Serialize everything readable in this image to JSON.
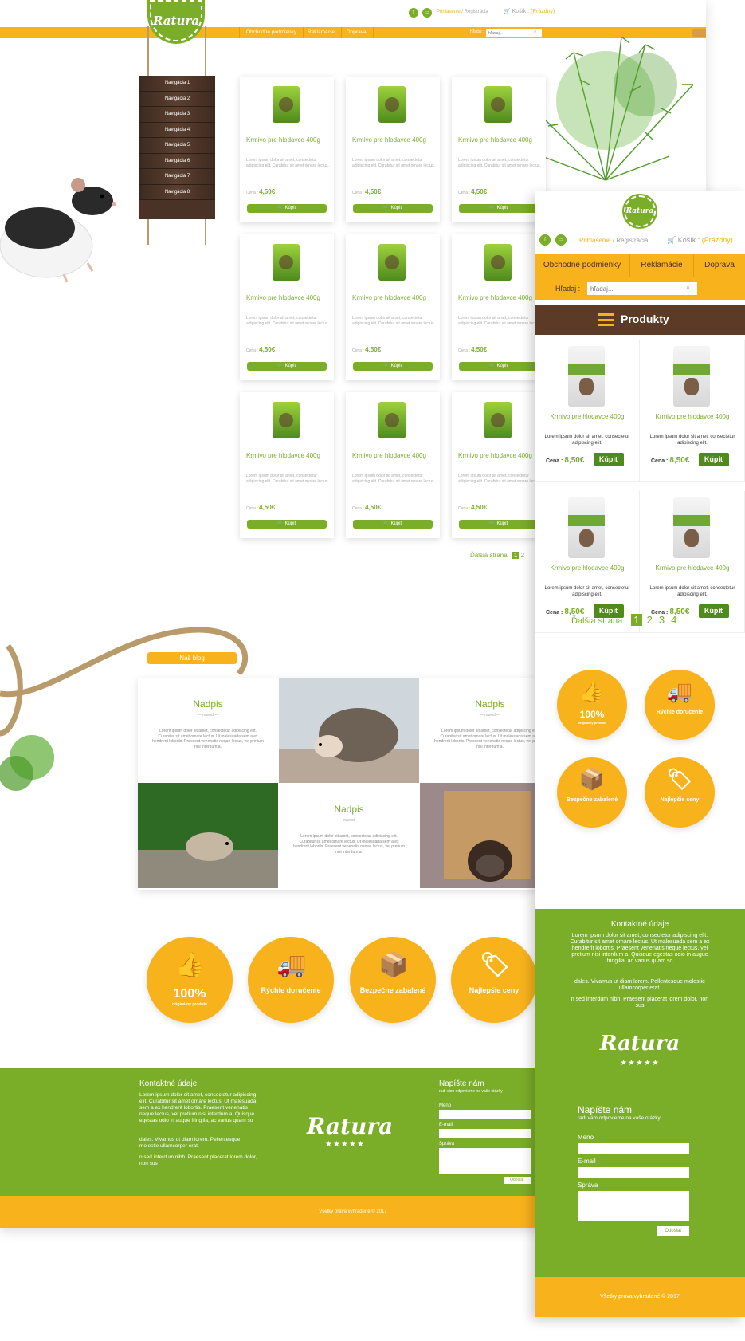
{
  "desktop": {
    "logo": "Ratura",
    "header": {
      "login": "Prihlásenie",
      "sep": "/",
      "register": "Registrácia",
      "cart": "Košík :",
      "cart_state": "(Prázdny)"
    },
    "nav": [
      "Obchodné podmienky",
      "Reklamácie",
      "Doprava"
    ],
    "search": {
      "label": "Hľadaj :",
      "placeholder": "hľadaj..."
    },
    "sidebar": [
      "Navigácia 1",
      "Navigácia 2",
      "Navigácia 3",
      "Navigácia 4",
      "Navigácia 5",
      "Navigácia 6",
      "Navigácia 7",
      "Navigácia 8"
    ],
    "product": {
      "title": "Krmivo pre hlodavce 400g",
      "desc": "Lorem ipsum dolor sit amet, consectetur adipiscing elit. Curabitur sit amet ornare lectus.",
      "price_label": "Cena :",
      "price": "4,50€",
      "buy": "Kúpiť"
    },
    "pagination": {
      "label": "Ďalšia strana",
      "pages": [
        "1",
        "2"
      ]
    },
    "blog": {
      "tag": "Náš blog",
      "title": "Nadpis",
      "sub": "návod",
      "text": "Lorem ipsum dolor sit amet, consectetur adipiscing elit. Curabitur sit amet ornare lectus. Ut malesuada sem a ex hendrerit lobortis. Praesent venenatis neque lectus, vel pretium nisi interdum a."
    },
    "features": [
      {
        "icon": "thumbs-up-icon",
        "big": "100%",
        "label": "originálny produkt"
      },
      {
        "icon": "truck-icon",
        "big": "",
        "label": "Rýchle doručenie"
      },
      {
        "icon": "box-icon",
        "big": "",
        "label": "Bezpečne zabalené"
      },
      {
        "icon": "price-tag-icon",
        "big": "",
        "label": "Najlepšie ceny"
      }
    ],
    "contact": {
      "title": "Kontaktné údaje",
      "p1": "Lorem ipsum dolor sit amet, consectetur adipiscing elit. Curabitur sit amet ornare lectus. Ut malesuada sem a ex hendrerit lobortis. Praesent venenatis neque lectus, vel pretium nisi interdum a. Quisque egestas odio in augue fringilla, ac varius quam so",
      "p2": "dales. Vivamus ut diam lorem. Pellentesque molestie ullamcorper erat.",
      "p3": "n sed interdum nibh. Praesent placerat lorem dolor, non sus"
    },
    "form": {
      "title": "Napíšte nám",
      "sub": "radi vám odpovieme na vaše otázky",
      "name": "Meno",
      "email": "E-mail",
      "message": "Správa",
      "send": "Odoslať"
    },
    "stars": "★★★★★",
    "copyright": "Všetky práva vyhradené © 2017"
  },
  "mobile": {
    "logo": "Ratura",
    "header": {
      "login": "Prihlásenie",
      "sep": "/",
      "register": "Registrácia",
      "cart": "Košík :",
      "cart_state": "(Prázdny)"
    },
    "nav": [
      "Obchodné podmienky",
      "Reklamácie",
      "Doprava"
    ],
    "search": {
      "label": "Hľadaj :",
      "placeholder": "hľadaj..."
    },
    "products_heading": "Produkty",
    "product": {
      "title": "Krmivo pre hlodavce 400g",
      "desc": "Lorem ipsum dolor sit amet, consectetur adipiscing elit.",
      "price_label": "Cena :",
      "price": "8,50€",
      "buy": "Kúpiť"
    },
    "pagination": {
      "label": "Ďalšia strana",
      "pages": [
        "1",
        "2",
        "3",
        "4"
      ]
    },
    "features": [
      {
        "icon": "thumbs-up-icon",
        "big": "100%",
        "label": "originálny produkt"
      },
      {
        "icon": "truck-icon",
        "big": "",
        "label": "Rýchle doručenie"
      },
      {
        "icon": "box-icon",
        "big": "",
        "label": "Bezpečne zabalené"
      },
      {
        "icon": "price-tag-icon",
        "big": "",
        "label": "Najlepšie ceny"
      }
    ],
    "contact": {
      "title": "Kontaktné údaje",
      "p1": "Lorem ipsum dolor sit amet, consectetur adipiscing elit. Curabitur sit amet ornare lectus. Ut malesuada sem a ex hendrerit lobortis. Praesent venenatis neque lectus, vel pretium nisi interdum a. Quisque egestas odio in augue fringilla, ac varius quam so",
      "p2": "dales. Vivamus ut diam lorem. Pellentesque molestie ullamcorper erat.",
      "p3": "n sed interdum nibh. Praesent placerat lorem dolor, non sus"
    },
    "brand": "Ratura",
    "stars": "★★★★★",
    "form": {
      "title": "Napíšte nám",
      "sub": "radi vám odpovieme na vaše otázky",
      "name": "Meno",
      "email": "E-mail",
      "message": "Správa",
      "send": "Odoslať"
    },
    "copyright": "Všetky práva vyhradené © 2017"
  },
  "colors": {
    "green": "#7aad28",
    "orange": "#f8b21c",
    "brown": "#5b3b25"
  }
}
